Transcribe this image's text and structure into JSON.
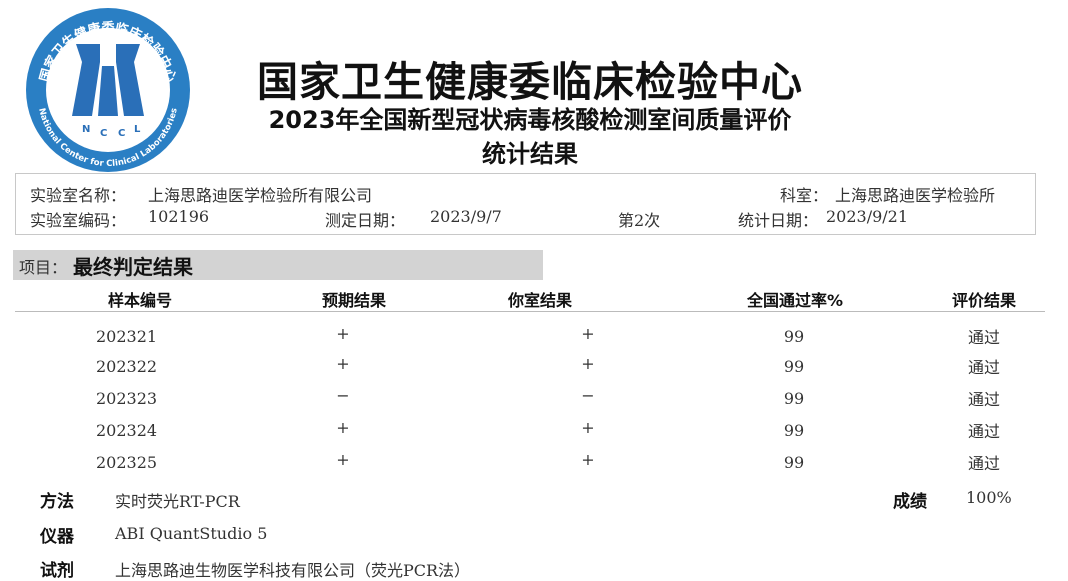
{
  "logo": {
    "text_cn": "国家卫生健康委临床检验中心",
    "text_en": "National Center for Clinical Laboratories",
    "abbr": [
      "N",
      "C",
      "C",
      "L"
    ],
    "colors": {
      "ring": "#2a7fc4",
      "mark": "#2a6fb8"
    }
  },
  "header": {
    "title": "国家卫生健康委临床检验中心",
    "subtitle": "2023年全国新型冠状病毒核酸检测室间质量评价",
    "subtitle2": "统计结果"
  },
  "info": {
    "lab_name_label": "实验室名称：",
    "lab_name": "上海思路迪医学检验所有限公司",
    "dept_label": "科室：",
    "dept": "上海思路迪医学检验所",
    "lab_code_label": "实验室编码：",
    "lab_code": "102196",
    "test_date_label": "测定日期：",
    "test_date": "2023/9/7",
    "round": "第2次",
    "stat_date_label": "统计日期：",
    "stat_date": "2023/9/21"
  },
  "section": {
    "label": "项目：",
    "value": "最终判定结果"
  },
  "table": {
    "headers": [
      "样本编号",
      "预期结果",
      "你室结果",
      "全国通过率%",
      "评价结果"
    ],
    "rows": [
      [
        "202321",
        "+",
        "+",
        "99",
        "通过"
      ],
      [
        "202322",
        "+",
        "+",
        "99",
        "通过"
      ],
      [
        "202323",
        "−",
        "−",
        "99",
        "通过"
      ],
      [
        "202324",
        "+",
        "+",
        "99",
        "通过"
      ],
      [
        "202325",
        "+",
        "+",
        "99",
        "通过"
      ]
    ]
  },
  "footer": {
    "method_label": "方法",
    "method": "实时荧光RT-PCR",
    "score_label": "成绩",
    "score": "100%",
    "instrument_label": "仪器",
    "instrument": "ABI QuantStudio 5",
    "reagent_label": "试剂",
    "reagent": "上海思路迪生物医学科技有限公司（荧光PCR法）"
  }
}
